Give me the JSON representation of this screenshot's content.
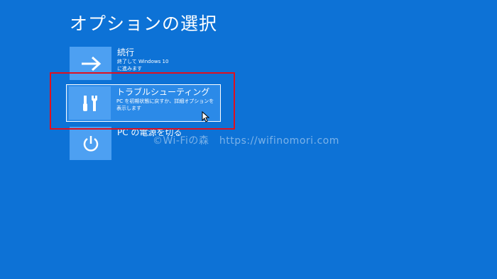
{
  "page": {
    "title": "オプションの選択"
  },
  "options": [
    {
      "label": "続行",
      "description": "終了して Windows 10\nに進みます",
      "icon": "arrow-right-icon"
    },
    {
      "label": "トラブルシューティング",
      "description": "PC を初期状態に戻すか、詳細オプションを\n表示します",
      "icon": "tools-icon"
    },
    {
      "label": "PC の電源を切る",
      "description": "",
      "icon": "power-icon"
    }
  ],
  "watermark": "©Wi-Fiの森　https://wifinomori.com",
  "colors": {
    "background": "#0d72d6",
    "tile": "#4da0f2",
    "highlight": "#e0101e"
  }
}
